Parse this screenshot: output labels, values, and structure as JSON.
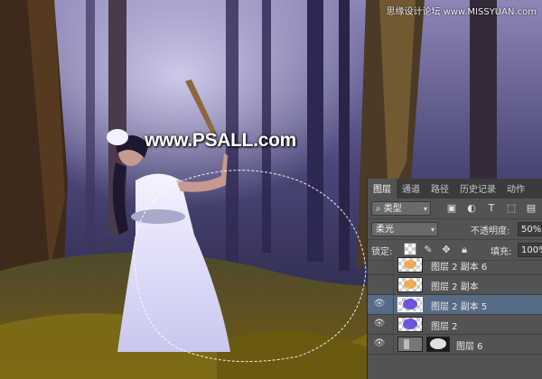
{
  "watermark": {
    "top": "思缘设计论坛 www.MISSYUAN.com",
    "center": "www.PSALL.com"
  },
  "layers_panel": {
    "tabs": [
      "图层",
      "通道",
      "路径",
      "历史记录",
      "动作"
    ],
    "active_tab": "图层",
    "filter_kind": "类型",
    "blend_mode": "柔光",
    "opacity_label": "不透明度:",
    "opacity_value": "50%",
    "lock_label": "锁定:",
    "fill_label": "填充:",
    "fill_value": "100%",
    "layers": [
      {
        "name": "图层 2 副本 6",
        "visible": false,
        "selected": false,
        "thumb": "orange-blob"
      },
      {
        "name": "图层 2 副本",
        "visible": false,
        "selected": false,
        "thumb": "orange-blob"
      },
      {
        "name": "图层 2 副本 5",
        "visible": true,
        "selected": true,
        "thumb": "purple-blob"
      },
      {
        "name": "图层 2",
        "visible": true,
        "selected": false,
        "thumb": "purple-blob"
      },
      {
        "name": "图层 6",
        "visible": true,
        "selected": false,
        "thumb": "photo-mask"
      }
    ]
  },
  "colors": {
    "panel_bg": "#535353",
    "selected_row": "#586b86",
    "tab_bar": "#3b3b3b"
  }
}
